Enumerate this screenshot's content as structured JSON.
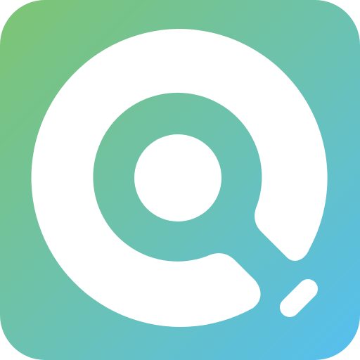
{
  "icon": {
    "name": "search-app-icon",
    "gradient_start": "#7DC472",
    "gradient_mid": "#6CC2AF",
    "gradient_end": "#55BFF0",
    "glyph_color": "#FFFFFF"
  }
}
